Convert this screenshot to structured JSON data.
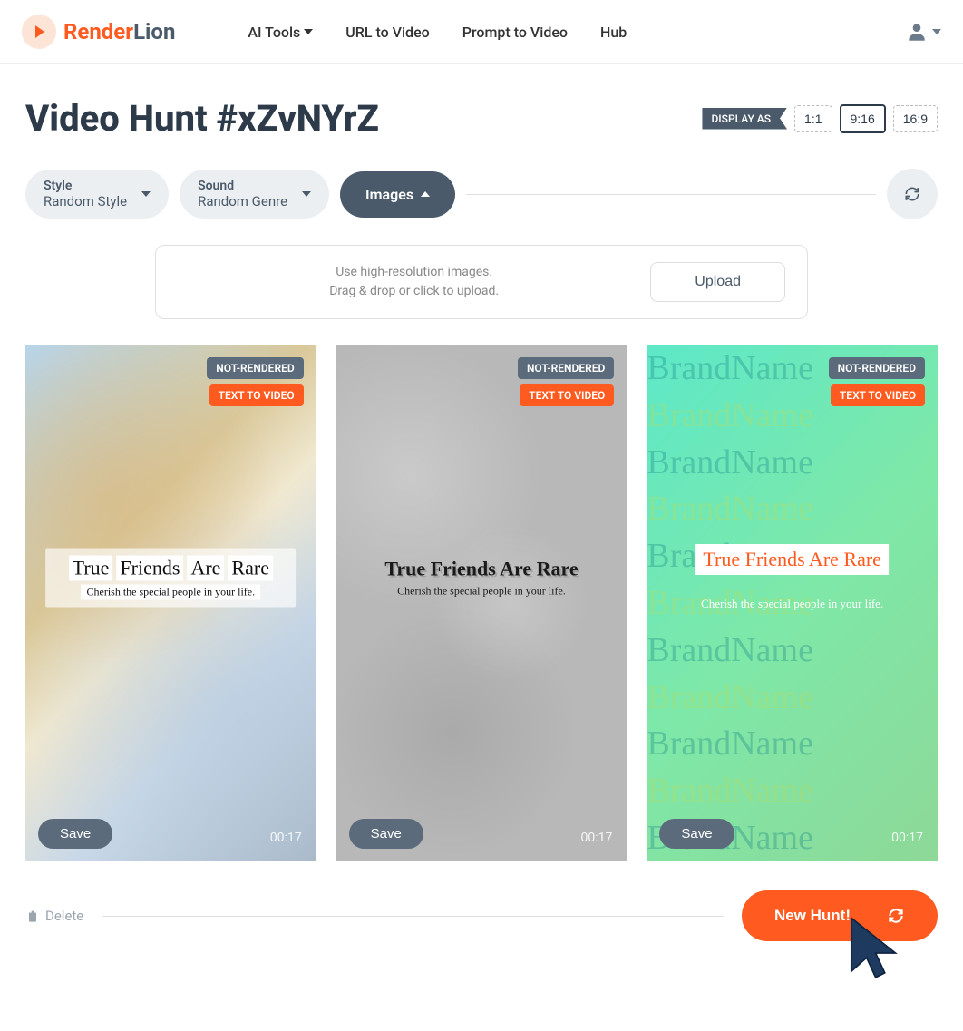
{
  "brand": {
    "part1": "Render",
    "part2": "Lion"
  },
  "nav": {
    "ai_tools": "AI Tools",
    "url_to_video": "URL to Video",
    "prompt_to_video": "Prompt to Video",
    "hub": "Hub"
  },
  "page": {
    "title": "Video Hunt #xZvNYrZ"
  },
  "display": {
    "label": "DISPLAY AS",
    "r11": "1:1",
    "r916": "9:16",
    "r169": "16:9"
  },
  "controls": {
    "style_label": "Style",
    "style_value": "Random Style",
    "sound_label": "Sound",
    "sound_value": "Random Genre",
    "images": "Images"
  },
  "upload": {
    "line1": "Use high-resolution images.",
    "line2": "Drag & drop or click to upload.",
    "button": "Upload"
  },
  "cards": {
    "badge_nr": "NOT-RENDERED",
    "badge_ttv": "TEXT TO VIDEO",
    "title_w1": "True",
    "title_w2": "Friends",
    "title_w3": "Are",
    "title_w4": "Rare",
    "title_full": "True Friends Are Rare",
    "subtitle": "Cherish the special people in your life.",
    "save": "Save",
    "duration": "00:17",
    "brandname": "BrandName"
  },
  "footer": {
    "delete": "Delete",
    "new_hunt": "New Hunt!"
  }
}
